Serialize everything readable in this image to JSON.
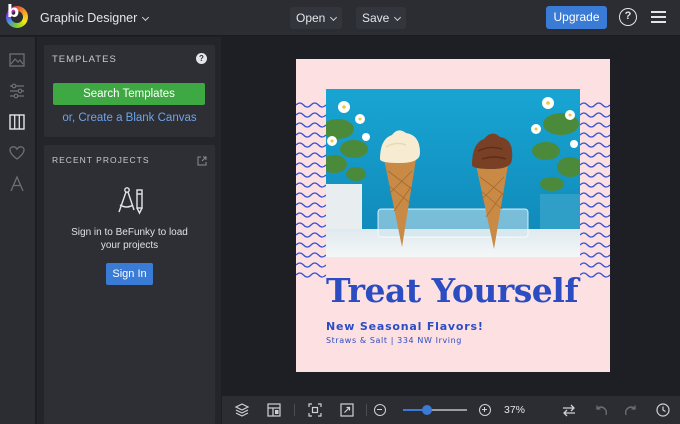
{
  "header": {
    "mode_label": "Graphic Designer",
    "open_label": "Open",
    "save_label": "Save",
    "upgrade_label": "Upgrade",
    "help_label": "?"
  },
  "rail": {
    "items": [
      "image-icon",
      "sliders-icon",
      "templates-icon",
      "heart-icon",
      "text-icon"
    ]
  },
  "templates": {
    "title": "TEMPLATES",
    "help_label": "?",
    "search_label": "Search Templates",
    "blank_label": "or, Create a Blank Canvas"
  },
  "recent": {
    "title": "RECENT PROJECTS",
    "signin_text_line1": "Sign in to BeFunky to load",
    "signin_text_line2": "your projects",
    "signin_label": "Sign In"
  },
  "design": {
    "headline": "Treat Yourself",
    "subhead": "New Seasonal Flavors!",
    "address": "Straws & Salt  |  334 NW Irving"
  },
  "footer": {
    "zoom_value": "37%",
    "zoom_fraction": 0.37
  },
  "colors": {
    "accent": "#3a7bd5",
    "green": "#3ea842",
    "design_blue": "#2c4cc2",
    "card_pink": "#fde0e2"
  }
}
